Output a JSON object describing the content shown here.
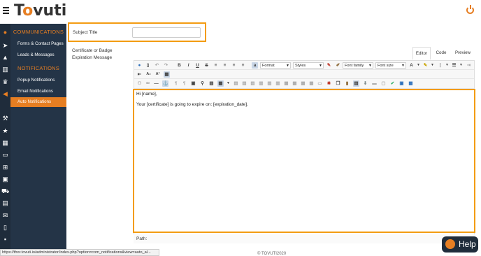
{
  "header": {
    "logo_text_1": "T",
    "logo_text_2": "vuti",
    "logo_accent": "o"
  },
  "sidebar": {
    "section1_title": "COMMUNICATIONS",
    "section1_items": [
      "Forms & Contact Pages",
      "Leads & Messages"
    ],
    "section2_title": "NOTIFICATIONS",
    "section2_items": [
      "Popup Notifications",
      "Email Notifications",
      "Auto Notifications"
    ],
    "active_item": "Auto Notifications"
  },
  "rail_icons": [
    "chat-icon",
    "rocket-icon",
    "graduation-icon",
    "chart-icon",
    "trophy-icon",
    "megaphone-icon",
    "gavel-icon",
    "star-icon",
    "table-icon",
    "card-icon",
    "org-icon",
    "id-icon",
    "cart-icon",
    "calendar-icon",
    "comments-icon",
    "document-icon",
    "person-icon"
  ],
  "form": {
    "subject_label": "Subject Title",
    "subject_value": "",
    "cert_label_line1": "Certificate or Badge",
    "cert_label_line2": "Expiration Message"
  },
  "tabs": [
    "Editor",
    "Code",
    "Preview"
  ],
  "toolbar": {
    "format": "Format",
    "styles": "Styles",
    "font_family": "Font family",
    "font_size": "Font size"
  },
  "content": {
    "line1": "Hi [name],",
    "line2": "Your [certificate] is going to expire on: [expiration_date]."
  },
  "path_label": "Path:",
  "status_url": "https://thor.tovuti.io/administrator/index.php?option=com_notifications&view=auto_al...",
  "footer_text": "© TOVUTI2020",
  "help_label": "Help",
  "colors": {
    "accent": "#e67e22",
    "highlight_border": "#f39c12",
    "sidebar_bg": "#243447"
  }
}
